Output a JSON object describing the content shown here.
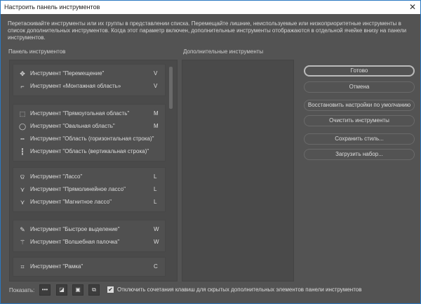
{
  "title": "Настроить панель инструментов",
  "description": "Перетаскивайте инструменты или их группы в представлении списка. Перемещайте лишние, неиспользуемые или низкоприоритетные инструменты в список дополнительных инструментов. Когда этот параметр включен, дополнительные инструменты отображаются в отдельной ячейке внизу на панели инструментов.",
  "toolbar_label": "Панель инструментов",
  "extra_label": "Дополнительные инструменты",
  "groups": [
    [
      {
        "icon": "move",
        "label": "Инструмент \"Перемещение\"",
        "key": "V"
      },
      {
        "icon": "artboard",
        "label": "Инструмент «Монтажная область»",
        "key": "V"
      }
    ],
    [
      {
        "icon": "rect-marquee",
        "label": "Инструмент \"Прямоугольная область\"",
        "key": "M"
      },
      {
        "icon": "ellipse-marquee",
        "label": "Инструмент \"Овальная область\"",
        "key": "M"
      },
      {
        "icon": "row-marquee",
        "label": "Инструмент \"Область (горизонтальная строка)\"",
        "key": ""
      },
      {
        "icon": "column-marquee",
        "label": "Инструмент \"Область (вертикальная строка)\"",
        "key": ""
      }
    ],
    [
      {
        "icon": "lasso",
        "label": "Инструмент \"Лассо\"",
        "key": "L"
      },
      {
        "icon": "polygonal-lasso",
        "label": "Инструмент \"Прямолинейное лассо\"",
        "key": "L"
      },
      {
        "icon": "magnetic-lasso",
        "label": "Инструмент \"Магнитное лассо\"",
        "key": "L"
      }
    ],
    [
      {
        "icon": "quick-selection",
        "label": "Инструмент \"Быстрое выделение\"",
        "key": "W"
      },
      {
        "icon": "magic-wand",
        "label": "Инструмент \"Волшебная палочка\"",
        "key": "W"
      }
    ],
    [
      {
        "icon": "crop",
        "label": "Инструмент \"Рамка\"",
        "key": "C"
      }
    ]
  ],
  "buttons": {
    "done": "Готово",
    "cancel": "Отмена",
    "restore": "Восстановить настройки по умолчанию",
    "clear": "Очистить инструменты",
    "save": "Сохранить стиль...",
    "load": "Загрузить набор..."
  },
  "footer": {
    "show_label": "Показать:",
    "checkbox_label": "Отключить сочетания клавиш для скрытых дополнительных элементов панели инструментов",
    "checked": true
  }
}
